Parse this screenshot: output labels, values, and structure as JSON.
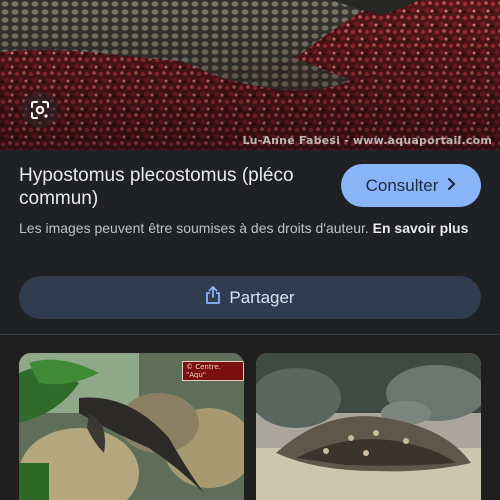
{
  "hero": {
    "watermark": "Lu-Anne Fabesi - www.aquaportail.com",
    "lens_icon": "google-lens-icon"
  },
  "result": {
    "title": "Hypostomus plecostomus (pléco commun)",
    "consult_label": "Consulter",
    "consult_icon": "chevron-right-icon",
    "copyright_text": "Les images peuvent être soumises à des droits d'auteur.",
    "learn_more_label": "En savoir plus",
    "share_label": "Partager",
    "share_icon": "share-icon"
  },
  "related": [
    {
      "stamp_text": "© Centre. \"Aqu\""
    },
    {
      "stamp_text": ""
    }
  ],
  "colors": {
    "background": "#202124",
    "consult_button": "#8ab4f8",
    "share_button": "#303d4f",
    "text_primary": "#e8eaed",
    "text_secondary": "#bdc1c6"
  }
}
